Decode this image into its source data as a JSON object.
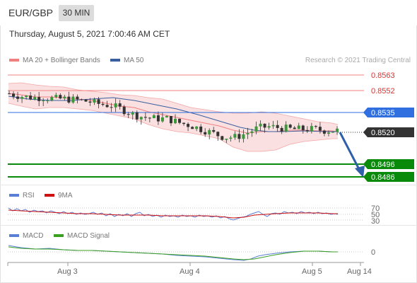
{
  "toolbar": {
    "pair": "EUR/GBP",
    "timeframe": "30 MIN"
  },
  "datetime": "Thursday, August 5, 2021 7:00:46 AM CET",
  "legend_main": {
    "bb_label": "MA 20 + Bollinger Bands",
    "ma50_label": "MA 50",
    "bb_color": "#f08080",
    "ma50_color": "#3a5fa0"
  },
  "credit": "Research © 2021 Trading Central",
  "rsi_legend": {
    "rsi_label": "RSI",
    "ma_label": "9MA",
    "rsi_color": "#5a7fd6",
    "ma_color": "#d01010"
  },
  "macd_legend": {
    "macd_label": "MACD",
    "signal_label": "MACD Signal",
    "macd_color": "#5a7fd6",
    "signal_color": "#3aa020"
  },
  "price_labels": {
    "r2": "0.8563",
    "r1": "0.8552",
    "pivot": "0.8535",
    "last": "0.8520",
    "s1": "0.8496",
    "s2": "0.8486"
  },
  "rsi_levels": {
    "upper": "70",
    "mid": "50",
    "lower": "30"
  },
  "macd_zero": "0",
  "x_axis": {
    "d1": "Aug 3",
    "d2": "Aug 4",
    "d3": "Aug 5",
    "d4": "Aug 14"
  },
  "colors": {
    "resistance": "#f08080",
    "pivot": "#2f6fe0",
    "support": "#0a8a0a",
    "last": "#333333",
    "arrow": "#2f5fa8"
  },
  "chart_data": {
    "type": "candlestick",
    "instrument": "EUR/GBP",
    "timeframe": "30 MIN",
    "levels": [
      0.8563,
      0.8552,
      0.8535,
      0.852,
      0.8496,
      0.8486
    ],
    "last_price": 0.852,
    "forecast_target": 0.8486,
    "x_ticks": [
      "Aug 3",
      "Aug 4",
      "Aug 5",
      "Aug 14"
    ],
    "rsi_levels": [
      70,
      50,
      30
    ],
    "macd_zero": 0,
    "close_path": [
      0.8549,
      0.8547,
      0.8546,
      0.8546,
      0.8545,
      0.8545,
      0.8544,
      0.8543,
      0.8541,
      0.854,
      0.8537,
      0.8533,
      0.8531,
      0.853,
      0.853,
      0.8527,
      0.8525,
      0.8522,
      0.8519,
      0.8516,
      0.8516,
      0.8519,
      0.8523,
      0.8524,
      0.8523,
      0.8522,
      0.8522,
      0.8522,
      0.8521,
      0.8521
    ]
  }
}
